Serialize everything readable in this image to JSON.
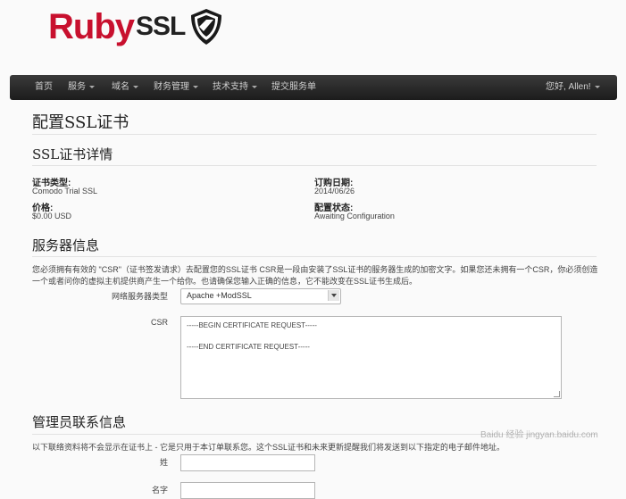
{
  "brand": {
    "ruby": "Ruby",
    "ssl": "SSL"
  },
  "nav": {
    "items": [
      {
        "label": "首页",
        "dropdown": false
      },
      {
        "label": "服务",
        "dropdown": true
      },
      {
        "label": "域名",
        "dropdown": true
      },
      {
        "label": "财务管理",
        "dropdown": true
      },
      {
        "label": "技术支持",
        "dropdown": true
      },
      {
        "label": "提交服务单",
        "dropdown": false
      }
    ],
    "user": "您好, Allen!"
  },
  "page": {
    "title": "配置SSL证书",
    "details_heading": "SSL证书详情",
    "details": {
      "cert_type_label": "证书类型:",
      "cert_type_value": "Comodo Trial SSL",
      "price_label": "价格:",
      "price_value": "$0.00 USD",
      "order_date_label": "订购日期:",
      "order_date_value": "2014/06/26",
      "config_status_label": "配置状态:",
      "config_status_value": "Awaiting Configuration"
    },
    "server_heading": "服务器信息",
    "server_desc": "您必须拥有有效的 \"CSR\"（证书签发请求）去配置您的SSL证书 CSR是一段由安装了SSL证书的服务器生成的加密文字。如果您还未拥有一个CSR，你必须创造一个或者问你的虚拟主机提供商产生一个给你。也请确保您输入正确的信息，它不能改变在SSL证书生成后。",
    "server_type_label": "网络服务器类型",
    "server_type_value": "Apache +ModSSL",
    "csr_label": "CSR",
    "csr_begin": "-----BEGIN CERTIFICATE REQUEST-----",
    "csr_end": "-----END CERTIFICATE REQUEST-----",
    "admin_heading": "管理员联系信息",
    "admin_desc": "以下联络资料将不会显示在证书上 - 它是只用于本订单联系您。这个SSL证书和未来更新提醒我们将发送到以下指定的电子邮件地址。",
    "last_name_label": "姓",
    "first_name_label": "名字"
  },
  "watermark": "Baidu 经验 jingyan.baidu.com"
}
